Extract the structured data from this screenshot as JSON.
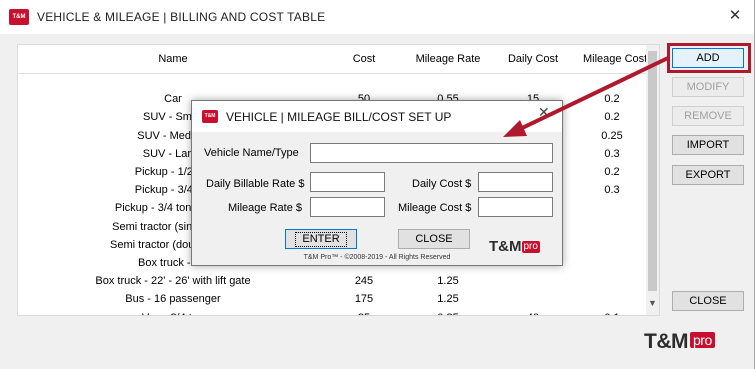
{
  "window": {
    "logo_text": "T&M",
    "title": "VEHICLE & MILEAGE | BILLING AND COST TABLE",
    "close_glyph": "✕"
  },
  "table": {
    "headers": [
      "Name",
      "Cost",
      "Mileage Rate",
      "Daily Cost",
      "Mileage Cost"
    ],
    "rows": [
      [
        "",
        "",
        "",
        "",
        ""
      ],
      [
        "Car",
        "50",
        "0.55",
        "15",
        "0.2"
      ],
      [
        "SUV - Small",
        "",
        "",
        "",
        "0.2"
      ],
      [
        "SUV - Medium",
        "",
        "",
        "",
        "0.25"
      ],
      [
        "SUV - Large",
        "",
        "",
        "",
        "0.3"
      ],
      [
        "Pickup - 1/2 ton",
        "",
        "",
        "",
        "0.2"
      ],
      [
        "Pickup - 3/4 ton",
        "",
        "",
        "",
        "0.3"
      ],
      [
        "Pickup - 3/4 ton to 1 ton",
        "",
        "",
        "",
        ""
      ],
      [
        "Semi tractor (single axle)",
        "",
        "",
        "",
        ""
      ],
      [
        "Semi tractor (double axle)",
        "",
        "",
        "",
        ""
      ],
      [
        "Box truck - 16'",
        "",
        "",
        "",
        ""
      ],
      [
        "Box truck - 22' - 26' with lift gate",
        "245",
        "1.25",
        "",
        ""
      ],
      [
        "Bus - 16 passenger",
        "175",
        "1.25",
        "",
        ""
      ],
      [
        "Van - 3/4 ton",
        "85",
        "0.85",
        "40",
        "0.1"
      ]
    ]
  },
  "side_buttons": {
    "add": "ADD",
    "modify": "MODIFY",
    "remove": "REMOVE",
    "import": "IMPORT",
    "export": "EXPORT",
    "close": "CLOSE"
  },
  "brand": {
    "name": "T&M",
    "pro": "pro"
  },
  "dialog": {
    "logo_text": "T&M",
    "title": "VEHICLE | MILEAGE BILL/COST SET UP",
    "close_glyph": "✕",
    "labels": {
      "vehicle_name": "Vehicle Name/Type",
      "daily_billable_rate": "Daily Billable Rate $",
      "daily_cost": "Daily Cost $",
      "mileage_rate": "Mileage Rate $",
      "mileage_cost": "Mileage Cost $"
    },
    "values": {
      "vehicle_name": "",
      "daily_billable_rate": "",
      "daily_cost": "",
      "mileage_rate": "",
      "mileage_cost": ""
    },
    "enter_button": "ENTER",
    "close_button": "CLOSE",
    "brand": {
      "name": "T&M",
      "pro": "pro"
    },
    "copyright": "T&M Pro™ - ©2008-2019 - All Rights Reserved"
  },
  "colors": {
    "brand_red": "#c8102e",
    "highlight_red": "#b0182b"
  }
}
